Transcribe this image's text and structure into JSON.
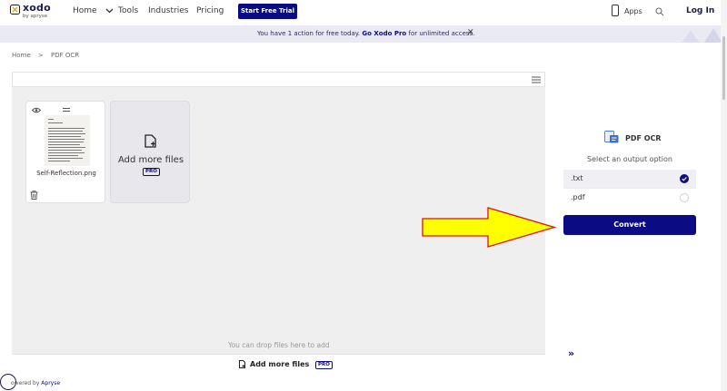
{
  "brand": {
    "name": "xodo",
    "tagline": "by apryse"
  },
  "nav": {
    "home": "Home",
    "tools": "Tools",
    "industries": "Industries",
    "pricing": "Pricing",
    "trial_button": "Start Free Trial",
    "apps": "Apps",
    "login": "Log In"
  },
  "banner": {
    "text_before": "You have 1 action for free today.",
    "link": "Go Xodo Pro",
    "text_after": "for unlimited access.",
    "close": "✕"
  },
  "breadcrumb": {
    "home": "Home",
    "separator": ">",
    "current": "PDF OCR"
  },
  "files": [
    {
      "name": "Self-Reflection.png"
    }
  ],
  "add_card": {
    "label": "Add more files",
    "badge": "PRO"
  },
  "drop_hint": "You can drop files here to add",
  "bottom_bar": {
    "label": "Add more files",
    "badge": "PRO"
  },
  "footer": {
    "prefix": "owered by",
    "brand": "Apryse"
  },
  "panel": {
    "title": "PDF OCR",
    "select_label": "Select an output option",
    "options": [
      {
        "label": ".txt",
        "selected": true
      },
      {
        "label": ".pdf",
        "selected": false
      }
    ],
    "convert_button": "Convert",
    "collapse": "»"
  },
  "colors": {
    "brand": "#0b0b83",
    "banner_bg": "#eaeaf5",
    "arrow_fill": "#ffff00",
    "arrow_stroke": "#d11"
  }
}
